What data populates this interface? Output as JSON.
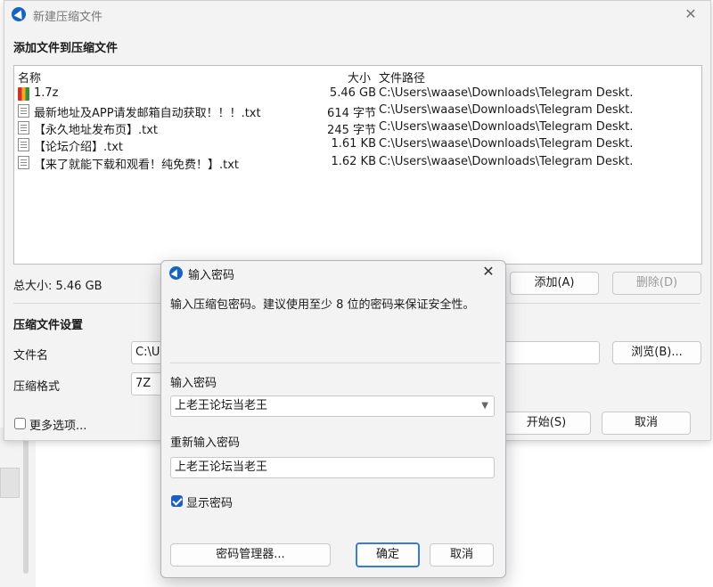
{
  "window": {
    "title": "新建压缩文件",
    "close_icon": "✕"
  },
  "add_section": {
    "heading": "添加文件到压缩文件",
    "columns": {
      "name": "名称",
      "size": "大小",
      "path": "文件路径"
    },
    "files": [
      {
        "icon": "archive-icon",
        "name": "1.7z",
        "size": "5.46 GB",
        "path": "C:\\Users\\waase\\Downloads\\Telegram Deskt..."
      },
      {
        "icon": "text-file-icon",
        "name": "最新地址及APP请发邮箱自动获取！！！.txt",
        "size": "614 字节",
        "path": "C:\\Users\\waase\\Downloads\\Telegram Deskt..."
      },
      {
        "icon": "text-file-icon",
        "name": "【永久地址发布页】.txt",
        "size": "245 字节",
        "path": "C:\\Users\\waase\\Downloads\\Telegram Deskt..."
      },
      {
        "icon": "text-file-icon",
        "name": "【论坛介绍】.txt",
        "size": "1.61 KB",
        "path": "C:\\Users\\waase\\Downloads\\Telegram Deskt..."
      },
      {
        "icon": "text-file-icon",
        "name": "【来了就能下载和观看！纯免费！】.txt",
        "size": "1.62 KB",
        "path": "C:\\Users\\waase\\Downloads\\Telegram Deskt..."
      }
    ],
    "total_size": "总大小: 5.46 GB",
    "add_button": "添加(A)",
    "delete_button": "删除(D)"
  },
  "settings": {
    "heading": "压缩文件设置",
    "filename_label": "文件名",
    "filename_value": "C:\\Us",
    "browse_button": "浏览(B)...",
    "format_label": "压缩格式",
    "format_value": "7Z",
    "more_options_label": "更多选项...",
    "more_options_checked": false,
    "start_button": "开始(S)",
    "cancel_button": "取消"
  },
  "password_dialog": {
    "title": "输入密码",
    "instructions": "输入压缩包密码。建议使用至少 8 位的密码来保证安全性。",
    "password_label": "输入密码",
    "password_value": "上老王论坛当老王",
    "confirm_label": "重新输入密码",
    "confirm_value": "上老王论坛当老王",
    "show_password_label": "显示密码",
    "show_password_checked": true,
    "manager_button": "密码管理器...",
    "ok_button": "确定",
    "cancel_button": "取消"
  },
  "colors": {
    "accent": "#3a7bd5",
    "checkbox_checked": "#1f5fbf",
    "window_bg": "#f3f3f3"
  }
}
